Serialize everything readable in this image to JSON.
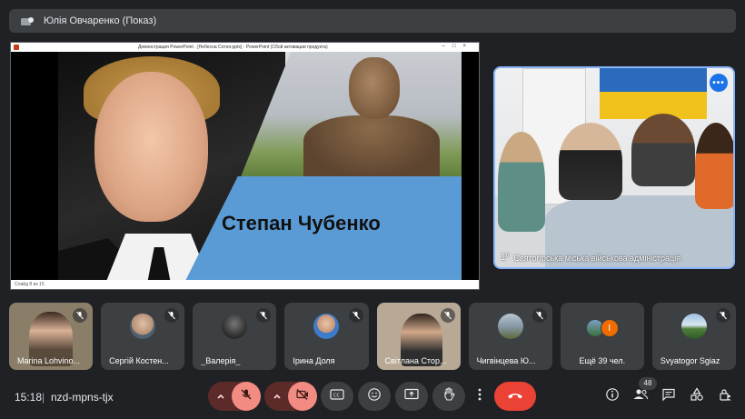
{
  "presenter": {
    "title": "Юлія Овчаренко (Показ)"
  },
  "shared_screen": {
    "window_caption": "Демонстрация PowerPoint - [Небесна Сотня.pptx] - PowerPoint (Сбой активации продукта)",
    "slide_status": "Слайд 8 из 15",
    "slide_name": "Степан Чубенко"
  },
  "main_video": {
    "label": "Святогірська міська військова адміністрація",
    "mark": "1⁰"
  },
  "tiles": [
    {
      "name": "Marina Lohvino...",
      "type": "video"
    },
    {
      "name": "Сергій Костен...",
      "type": "avatar"
    },
    {
      "name": "_Валерія_",
      "type": "avatar"
    },
    {
      "name": "Ірина Доля",
      "type": "avatar"
    },
    {
      "name": "Світлана Стор...",
      "type": "video"
    },
    {
      "name": "Чигвінцева Ю...",
      "type": "avatar"
    },
    {
      "name": "Ещё 39 чел.",
      "type": "more",
      "initial": "І"
    },
    {
      "name": "Svyatogor Sgiaz",
      "type": "avatar"
    }
  ],
  "bottom": {
    "time": "15:18",
    "separator": "|",
    "meeting_code": "nzd-mpns-tjx",
    "participants_count": "48"
  },
  "colors": {
    "accent": "#8ab4f8",
    "hangup": "#ea4335",
    "muted": "#f28b82"
  }
}
